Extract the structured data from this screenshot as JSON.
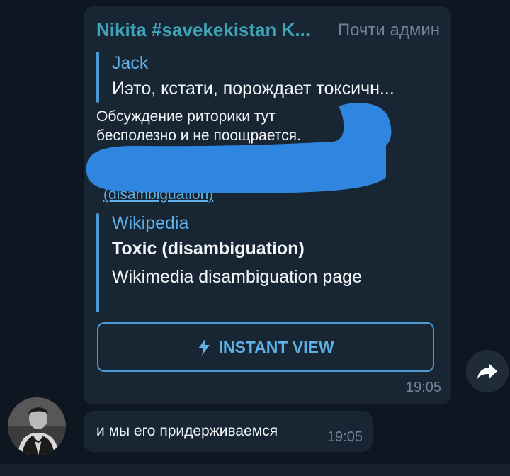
{
  "message": {
    "sender": "Nikita #savekekistan K...",
    "admin_tag": "Почти админ",
    "reply": {
      "author": "Jack",
      "text": "Иэто, кстати, порождает токсичн..."
    },
    "body_text": "Обсуждение риторики тут бесполезно и не поощрается.",
    "link_text": "(disambiguation)",
    "preview": {
      "site": "Wikipedia",
      "title": "Toxic (disambiguation)",
      "description": "Wikimedia disambiguation page"
    },
    "instant_view_label": "INSTANT VIEW",
    "time": "19:05"
  },
  "message2": {
    "text": "и мы его придерживаемся",
    "time": "19:05"
  },
  "icons": {
    "forward": "forward-arrow-icon",
    "instant_view": "lightning-icon"
  },
  "colors": {
    "background": "#0e1621",
    "bubble": "#182533",
    "accent": "#5fb0e6",
    "sender": "#3fa3b8",
    "scribble": "#2f86e0"
  }
}
